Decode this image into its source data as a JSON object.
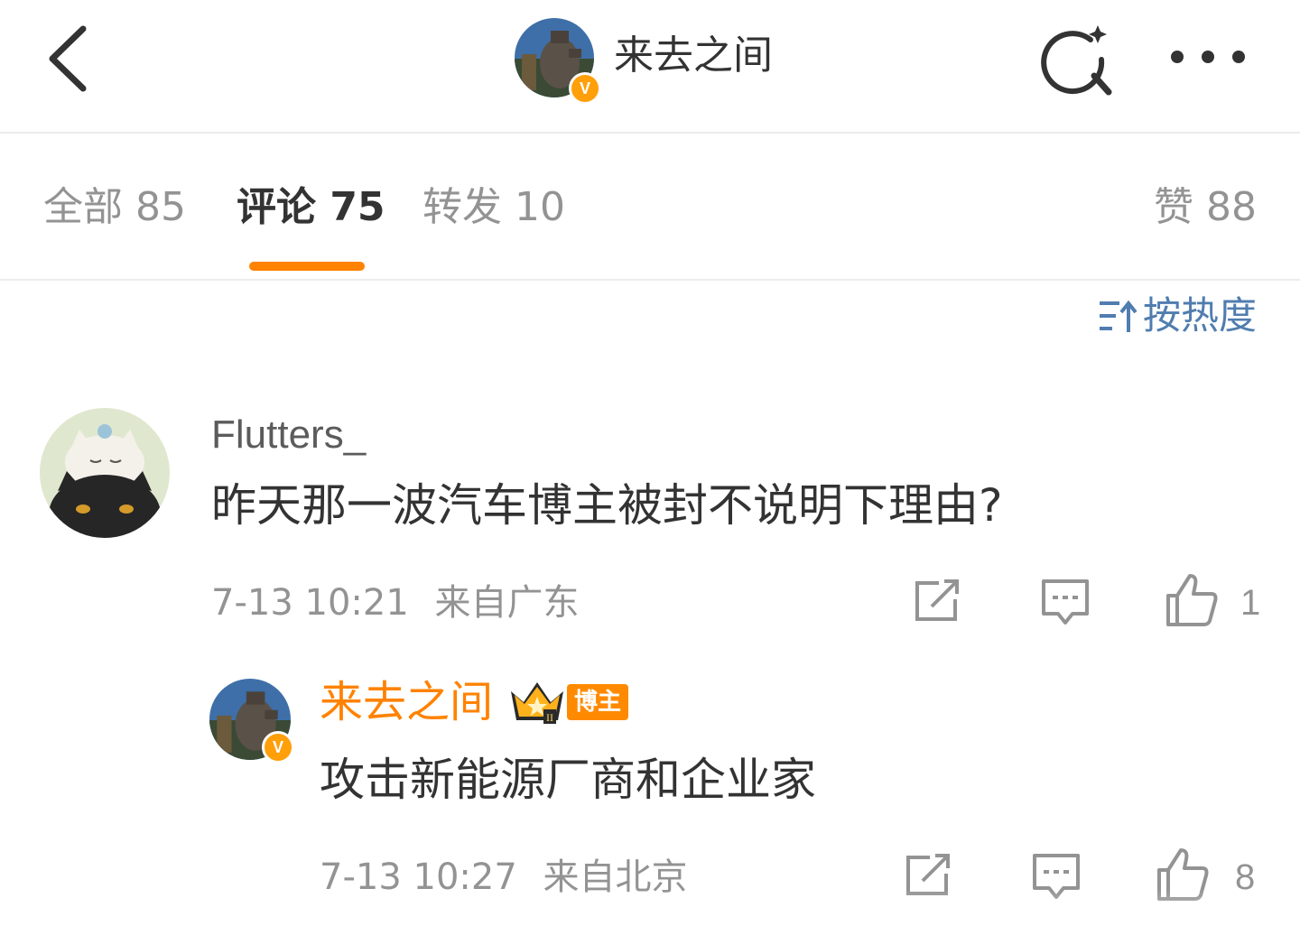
{
  "header": {
    "title": "来去之间",
    "verified_badge": "V",
    "icons": [
      "back-icon",
      "search-sparkle-icon",
      "more-icon"
    ]
  },
  "tabs": [
    {
      "label": "全部 85",
      "active": false
    },
    {
      "label": "评论 75",
      "active": true
    },
    {
      "label": "转发 10",
      "active": false
    }
  ],
  "likes_tab": {
    "label": "赞 88"
  },
  "sort": {
    "label": "按热度",
    "icon": "sort-icon"
  },
  "comments": [
    {
      "username": "Flutters_",
      "text": "昨天那一波汽车博主被封不说明下理由?",
      "time": "7-13 10:21",
      "location": "来自广东",
      "like_count": "1",
      "reply": {
        "username": "来去之间",
        "badge": "博主",
        "badge_level": "II",
        "text": "攻击新能源厂商和企业家",
        "time": "7-13 10:27",
        "location": "来自北京",
        "like_count": "8"
      }
    }
  ],
  "colors": {
    "accent": "#ff8200",
    "sort_blue": "#507daf",
    "muted": "#939393",
    "text": "#333333"
  }
}
